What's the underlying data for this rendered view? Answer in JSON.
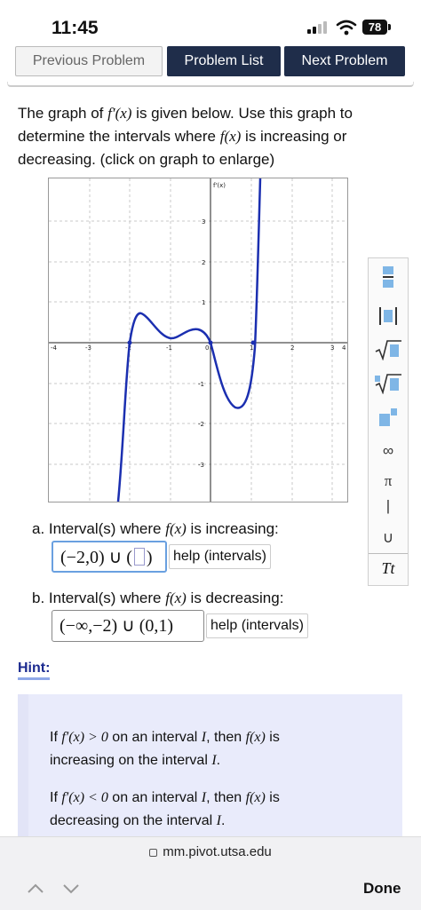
{
  "status": {
    "time": "11:45",
    "battery": "78"
  },
  "nav": {
    "previous": "Previous Problem",
    "list": "Problem List",
    "next": "Next Problem"
  },
  "prompt": {
    "line1_pre": "The graph of ",
    "fprime": "f′(x)",
    "line1_post": " is given below. Use this graph to",
    "line2_pre": "determine the intervals where ",
    "fx": "f(x)",
    "line2_post": " is increasing or",
    "line3": "decreasing. (click on graph to enlarge)"
  },
  "graph": {
    "label": "f'(x)",
    "x_ticks": [
      "-4",
      "-3",
      "-2",
      "-1",
      "0",
      "1",
      "2",
      "3",
      "4"
    ],
    "y_ticks": [
      "3",
      "2",
      "1",
      "-1",
      "-2",
      "-3"
    ]
  },
  "toolbar": {
    "infinity": "∞",
    "pi": "π",
    "bar": "|",
    "union": "∪",
    "text": "Tt"
  },
  "part_a": {
    "label_pre": "a.  Interval(s) where ",
    "fx": "f(x)",
    "label_post": " is increasing:",
    "answer": "(−2,0) ∪ (",
    "help": "help (intervals)"
  },
  "part_b": {
    "label_pre": "b.  Interval(s) where ",
    "fx": "f(x)",
    "label_post": " is decreasing:",
    "answer": "(−∞,−2) ∪ (0,1)",
    "help": "help (intervals)"
  },
  "hint": {
    "title": "Hint:",
    "p1_a": "If ",
    "p1_math": "f′(x) > 0",
    "p1_b": " on an interval ",
    "p1_I": "I",
    "p1_c": ", then ",
    "p1_fx": "f(x)",
    "p1_d": " is",
    "p1_e": "increasing on the interval ",
    "p2_a": "If ",
    "p2_math": "f′(x) < 0",
    "p2_b": " on an interval ",
    "p2_I": "I",
    "p2_c": ", then ",
    "p2_fx": "f(x)",
    "p2_d": " is",
    "p2_e": "decreasing on the interval "
  },
  "browser": {
    "url": "mm.pivot.utsa.edu",
    "done": "Done"
  },
  "colors": {
    "navy": "#1f2d4a",
    "curve": "#1b2fb0",
    "hint_bg": "#e9ebfb",
    "tool_accent": "#7fb6e6"
  }
}
